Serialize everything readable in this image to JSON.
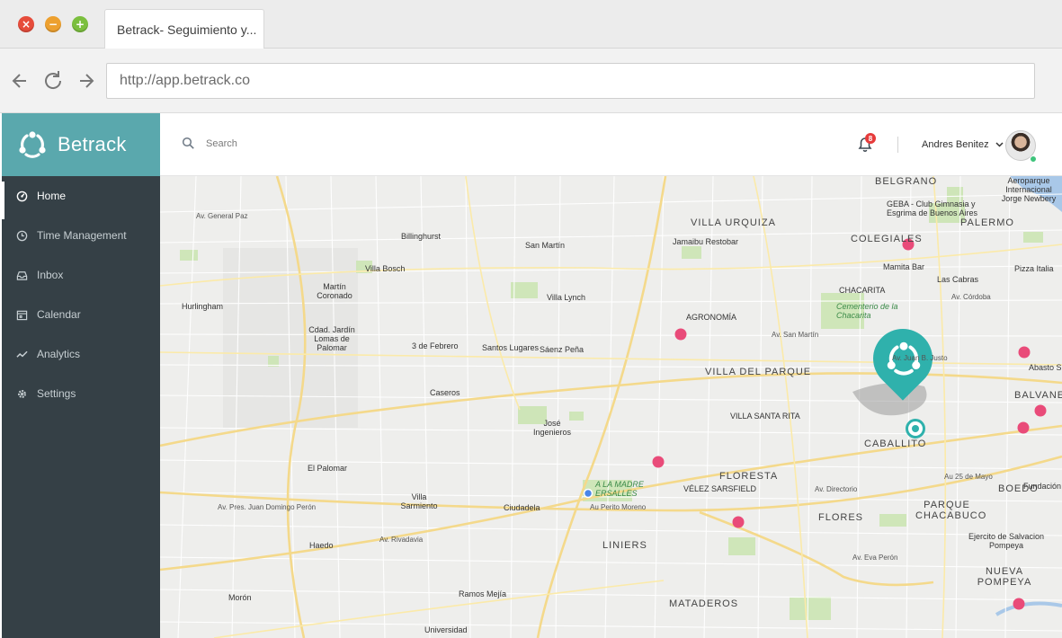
{
  "browser": {
    "tab_title": "Betrack- Seguimiento y...",
    "url": "http://app.betrack.co",
    "window_controls": [
      "close",
      "minimize",
      "maximize"
    ]
  },
  "app": {
    "brand": "Betrack",
    "search": {
      "placeholder": "Search"
    },
    "notifications": {
      "count": "8"
    },
    "user": {
      "name": "Andres Benitez"
    },
    "nav": [
      {
        "label": "Home",
        "icon": "dashboard-icon",
        "active": true
      },
      {
        "label": "Time Management",
        "icon": "clock-icon",
        "active": false
      },
      {
        "label": "Inbox",
        "icon": "inbox-icon",
        "active": false
      },
      {
        "label": "Calendar",
        "icon": "calendar-icon",
        "active": false
      },
      {
        "label": "Analytics",
        "icon": "chart-icon",
        "active": false
      },
      {
        "label": "Settings",
        "icon": "gear-icon",
        "active": false
      }
    ],
    "colors": {
      "brand": "#5aa8ad",
      "sidebar": "#354046",
      "marker": "#f03f6b",
      "pin": "#2fb1ac"
    }
  },
  "map": {
    "neighborhoods": {
      "belgrano": "BELGRANO",
      "colegiales": "COLEGIALES",
      "villa_urquiza": "VILLA URQUIZA",
      "villa_del_parque": "VILLA DEL PARQUE",
      "villa_santa_rita": "VILLA SANTA RITA",
      "caballito": "CABALLITO",
      "floresta": "FLORESTA",
      "flores": "FLORES",
      "parque_chacabuco": "PARQUE CHACABUCO",
      "boedo": "BOEDO",
      "liniers": "LINIERS",
      "mataderos": "MATADEROS",
      "nueva_pompeya": "NUEVA POMPEYA",
      "palermo": "PALERMO",
      "balvanera": "BALVANER",
      "chacarita": "CHACARITA",
      "velez": "VÉLEZ SARSFIELD",
      "agronomia": "AGRONOMÍA"
    },
    "places": {
      "villa_bosch": "Villa Bosch",
      "billinghurst": "Billinghurst",
      "san_martin": "San Martín",
      "villa_lynch": "Villa Lynch",
      "martin_coronado": "Martín Coronado",
      "hurlingham": "Hurlingham",
      "cdad_jardin": "Cdad. Jardín Lomas de Palomar",
      "tres_de_febrero": "3 de Febrero",
      "santos_lugares": "Santos Lugares",
      "saenz_pena": "Sáenz Peña",
      "caseros": "Caseros",
      "jose_ingenieros": "José Ingenieros",
      "el_palomar": "El Palomar",
      "villa_sarmiento": "Villa Sarmiento",
      "ciudadela": "Ciudadela",
      "haedo": "Haedo",
      "moron": "Morón",
      "ramos_mejia": "Ramos Mejía",
      "universidad": "Universidad",
      "la_madre": "A LA MADRE ERSALLES",
      "jamaibu": "Jamaibu Restobar",
      "mamita": "Mamita Bar",
      "las_cabras": "Las Cabras",
      "pizza_italia": "Pizza Italia",
      "geba": "GEBA - Club Gimnasia y Esgrima de Buenos Aires",
      "aeroparque": "Aeroparque Internacional Jorge Newbery",
      "cementerio": "Cementerio de la Chacarita",
      "abasto": "Abasto S",
      "fundacion": "Fundación Ca",
      "ejercito": "Ejercito de Salvacion Pompeya"
    },
    "streets": {
      "rivadavia": "Av. Rivadavia",
      "peron": "Av. Pres. Juan Domingo Perón",
      "perito_moreno": "Au Perito Moreno",
      "gral_paz": "Av. General Paz",
      "san_martin_av": "Av. San Martín",
      "directorio": "Av. Directorio",
      "eva_peron": "Av. Eva Perón",
      "juan_b_justo": "Av. Juan B. Justo",
      "cordoba": "Av. Córdoba",
      "25_mayo": "Au 25 de Mayo"
    },
    "markers": [
      {
        "name": "marker-1"
      },
      {
        "name": "marker-2"
      },
      {
        "name": "marker-3"
      },
      {
        "name": "marker-4"
      },
      {
        "name": "marker-5"
      },
      {
        "name": "marker-6"
      },
      {
        "name": "marker-7"
      },
      {
        "name": "marker-8"
      }
    ]
  }
}
